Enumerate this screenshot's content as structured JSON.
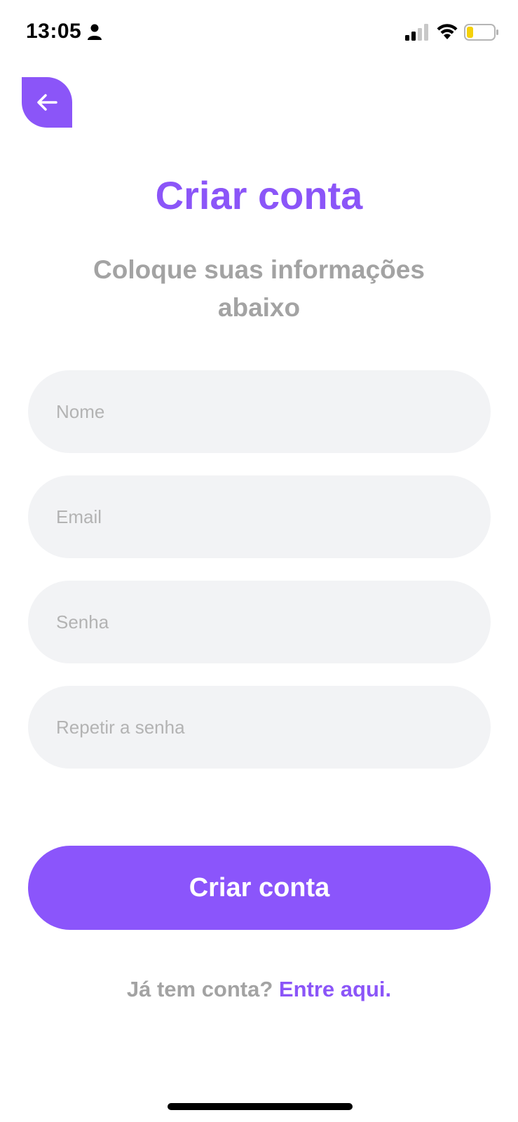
{
  "status_bar": {
    "time": "13:05",
    "icons": [
      "person-icon",
      "signal-icon",
      "wifi-icon",
      "battery-icon"
    ]
  },
  "header": {
    "back_icon": "arrow-left-icon",
    "title": "Criar conta",
    "subtitle": "Coloque suas informações abaixo"
  },
  "form": {
    "name_placeholder": "Nome",
    "email_placeholder": "Email",
    "password_placeholder": "Senha",
    "repeat_password_placeholder": "Repetir a senha",
    "submit_label": "Criar conta"
  },
  "footer": {
    "prompt": "Já tem conta?",
    "link": "Entre aqui."
  },
  "colors": {
    "accent": "#8b55f8",
    "field_background": "#f2f3f5",
    "muted_text": "#a3a3a3",
    "placeholder_text": "#b3b3b3",
    "battery_level": "#f5d10a"
  }
}
